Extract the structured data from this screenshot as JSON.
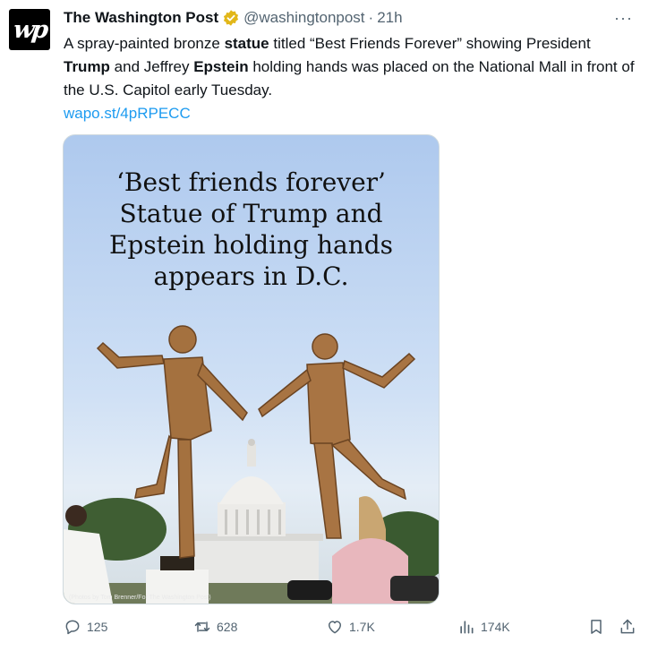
{
  "avatar": {
    "logo_text": "wp"
  },
  "header": {
    "name": "The Washington Post",
    "handle": "@washingtonpost",
    "separator": "·",
    "time": "21h",
    "more": "···"
  },
  "tweet": {
    "text_parts": [
      {
        "text": "A spray-painted bronze ",
        "bold": false
      },
      {
        "text": "statue",
        "bold": true
      },
      {
        "text": " titled “Best Friends Forever” showing President ",
        "bold": false
      },
      {
        "text": "Trump",
        "bold": true
      },
      {
        "text": " and Jeffrey ",
        "bold": false
      },
      {
        "text": "Epstein",
        "bold": true
      },
      {
        "text": " holding hands was placed on the National Mall in front of the U.S. Capitol early Tuesday.",
        "bold": false
      }
    ],
    "link": "wapo.st/4pRPECC"
  },
  "media": {
    "headline_lines": [
      "‘Best friends forever’",
      "Statue of Trump and",
      "Epstein holding hands",
      "appears in D.C."
    ],
    "credit": "(Photos by Tom Brenner/For The Washington Post)"
  },
  "actions": {
    "replies": "125",
    "reposts": "628",
    "likes": "1.7K",
    "views": "174K"
  },
  "colors": {
    "link": "#1d9bf0",
    "secondary_text": "#536471",
    "verified_badge": "#e2b719"
  }
}
